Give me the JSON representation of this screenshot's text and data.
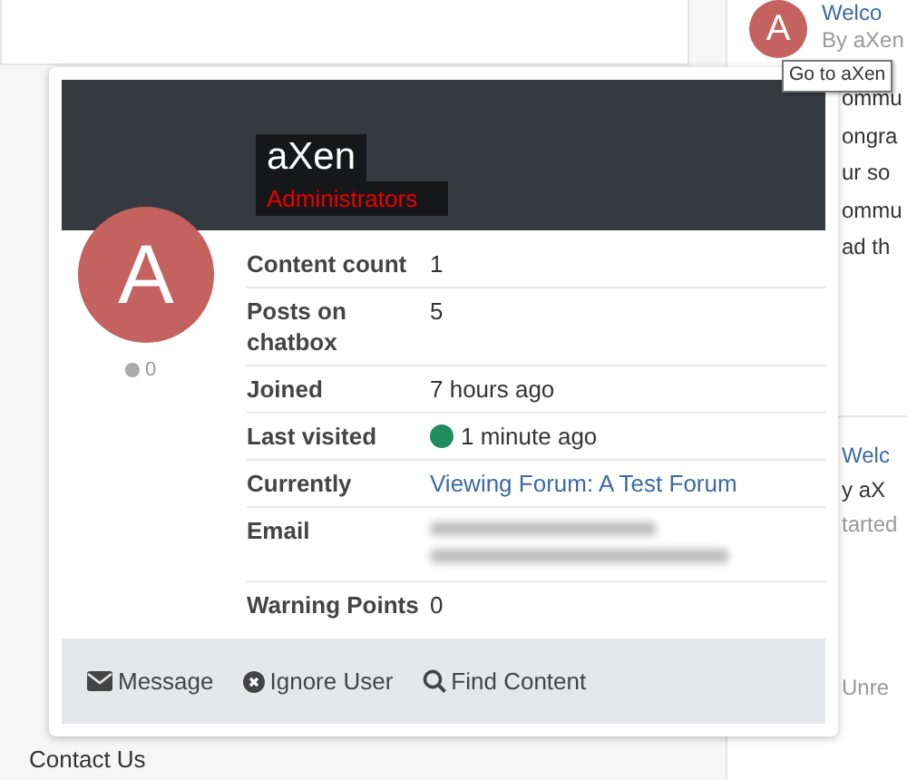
{
  "background": {
    "avatar_letter": "A",
    "welcome": "Welco",
    "author": "By aXen",
    "tooltip": "Go to aXen",
    "fragments": [
      "ommu",
      "ongra",
      "ur so",
      "ommu",
      "ad th"
    ],
    "lower_fragments": [
      "Welc",
      "y aX",
      "tarted"
    ],
    "unread": "Unre",
    "footer_link": "Contact Us"
  },
  "profile": {
    "name": "aXen",
    "group": "Administrators",
    "avatar_letter": "A",
    "reputation": "0",
    "fields": [
      {
        "label": "Content count",
        "kind": "text",
        "value": "1"
      },
      {
        "label": "Posts on chatbox",
        "kind": "text",
        "value": "5"
      },
      {
        "label": "Joined",
        "kind": "text",
        "value": "7 hours ago"
      },
      {
        "label": "Last visited",
        "kind": "status",
        "color": "#1e8e5e",
        "value": "1 minute ago"
      },
      {
        "label": "Currently",
        "kind": "link",
        "value": "Viewing Forum: A Test Forum"
      },
      {
        "label": "Email",
        "kind": "redacted"
      },
      {
        "label": "Warning Points",
        "kind": "text",
        "value": "0"
      }
    ],
    "actions": [
      {
        "kind": "message",
        "label": "Message"
      },
      {
        "kind": "ignore",
        "label": "Ignore User"
      },
      {
        "kind": "search",
        "label": "Find Content"
      }
    ]
  }
}
